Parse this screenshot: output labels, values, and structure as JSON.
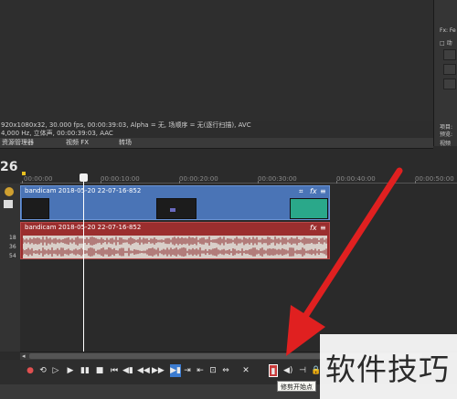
{
  "right_panel": {
    "line1": "Fx: Fe",
    "line2": "□ 动",
    "bottom_label1": "项目:",
    "bottom_label2": "预览:",
    "bottom_label3": "视频"
  },
  "info": {
    "line1": "920x1080x32, 30.000 fps, 00:00:39:03, Alpha = 无, 场顺序 = 无(逐行扫描), AVC",
    "line2": "4,000 Hz, 立体声, 00:00:39:03, AAC"
  },
  "tabs": [
    "资源管理器",
    "视频 FX",
    "转场"
  ],
  "timeline": {
    "current_time": "26",
    "ruler_labels": [
      "00:00:00",
      "00:00:10:00",
      "00:00:20:00",
      "00:00:30:00",
      "00:00:40:00",
      "00:00:50:00"
    ]
  },
  "video_clip": {
    "title": "bandicam 2018-05-20 22-07-16-852",
    "crop_icon": "⌗",
    "fx_icon": "fx",
    "menu_icon": "≡"
  },
  "audio_clip": {
    "title": "bandicam 2018-05-20 22-07-16-852",
    "fx_icon": "fx",
    "menu_icon": "≡"
  },
  "audio_levels": [
    "18",
    "36",
    "54"
  ],
  "transport": {
    "buttons": [
      "●",
      "⟲",
      "▷",
      "▶",
      "▮▮",
      "■",
      "⏮",
      "◀▮",
      "◀◀",
      "▶▶",
      "▶▮",
      "⇥",
      "⇤",
      "⊡",
      "⇔",
      "✕",
      "▮",
      "◀)",
      "⊣",
      "🔒"
    ]
  },
  "tooltip": "修剪开始点",
  "watermark": "软件技巧",
  "colors": {
    "video_clip": "#4a74b6",
    "audio_clip": "#9b2e2e",
    "arrow": "#e02020"
  }
}
